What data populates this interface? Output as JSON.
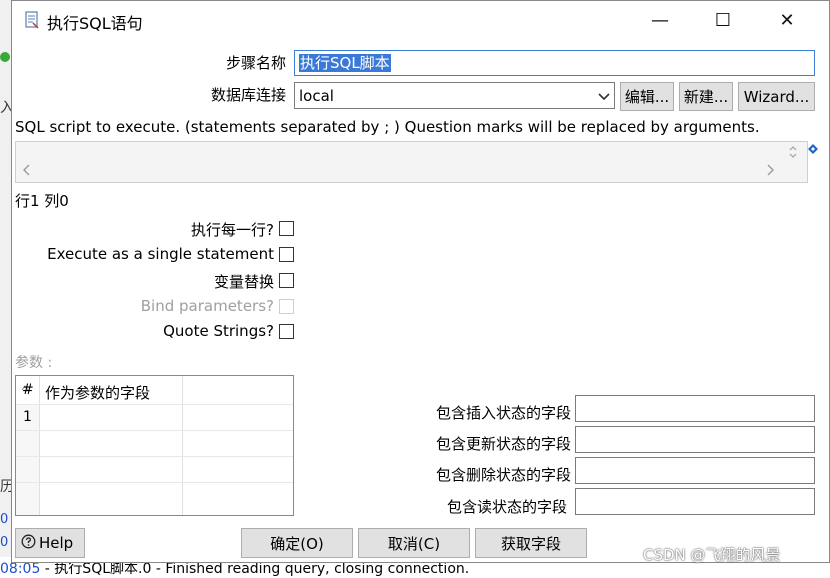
{
  "window": {
    "title": "执行SQL语句",
    "minimize": "—",
    "maximize": "☐",
    "close": "✕"
  },
  "form": {
    "step_name_label": "步骤名称",
    "step_name_value": "执行SQL脚本",
    "db_conn_label": "数据库连接",
    "db_conn_value": "local",
    "edit_button": "编辑...",
    "new_button": "新建...",
    "wizard_button": "Wizard...",
    "sql_instructions": "SQL script to execute. (statements separated by ; ) Question marks will be replaced by arguments.",
    "cursor_pos": "行1 列0"
  },
  "options": [
    {
      "label": "执行每一行?",
      "checked": false,
      "disabled": false
    },
    {
      "label": "Execute as a single statement",
      "checked": false,
      "disabled": false
    },
    {
      "label": "变量替换",
      "checked": false,
      "disabled": false
    },
    {
      "label": "Bind parameters?",
      "checked": false,
      "disabled": true
    },
    {
      "label": "Quote Strings?",
      "checked": false,
      "disabled": false
    }
  ],
  "params": {
    "label": "参数 :",
    "columns": [
      "#",
      "作为参数的字段"
    ],
    "rows": [
      {
        "num": "1",
        "field": ""
      }
    ]
  },
  "status_fields": [
    {
      "label": "包含插入状态的字段",
      "value": ""
    },
    {
      "label": "包含更新状态的字段",
      "value": ""
    },
    {
      "label": "包含删除状态的字段",
      "value": ""
    },
    {
      "label": "包含读状态的字段",
      "value": ""
    }
  ],
  "footer": {
    "help": "Help",
    "ok": "确定(O)",
    "cancel": "取消(C)",
    "get_fields": "获取字段",
    "watermark": "CSDN @飞翔的风景"
  },
  "background": {
    "log_time": "08:05",
    "log_text": " - 执行SQL脚本.0 - Finished reading query, closing connection.",
    "side_char_1": "入",
    "side_char_2": "历",
    "side_num_1": "0",
    "side_num_2": "0"
  },
  "colors": {
    "selection": "#3a79d8",
    "focus_border": "#3c7fd6",
    "button_bg": "#e1e1e1",
    "log_time": "#1a4fd0"
  }
}
